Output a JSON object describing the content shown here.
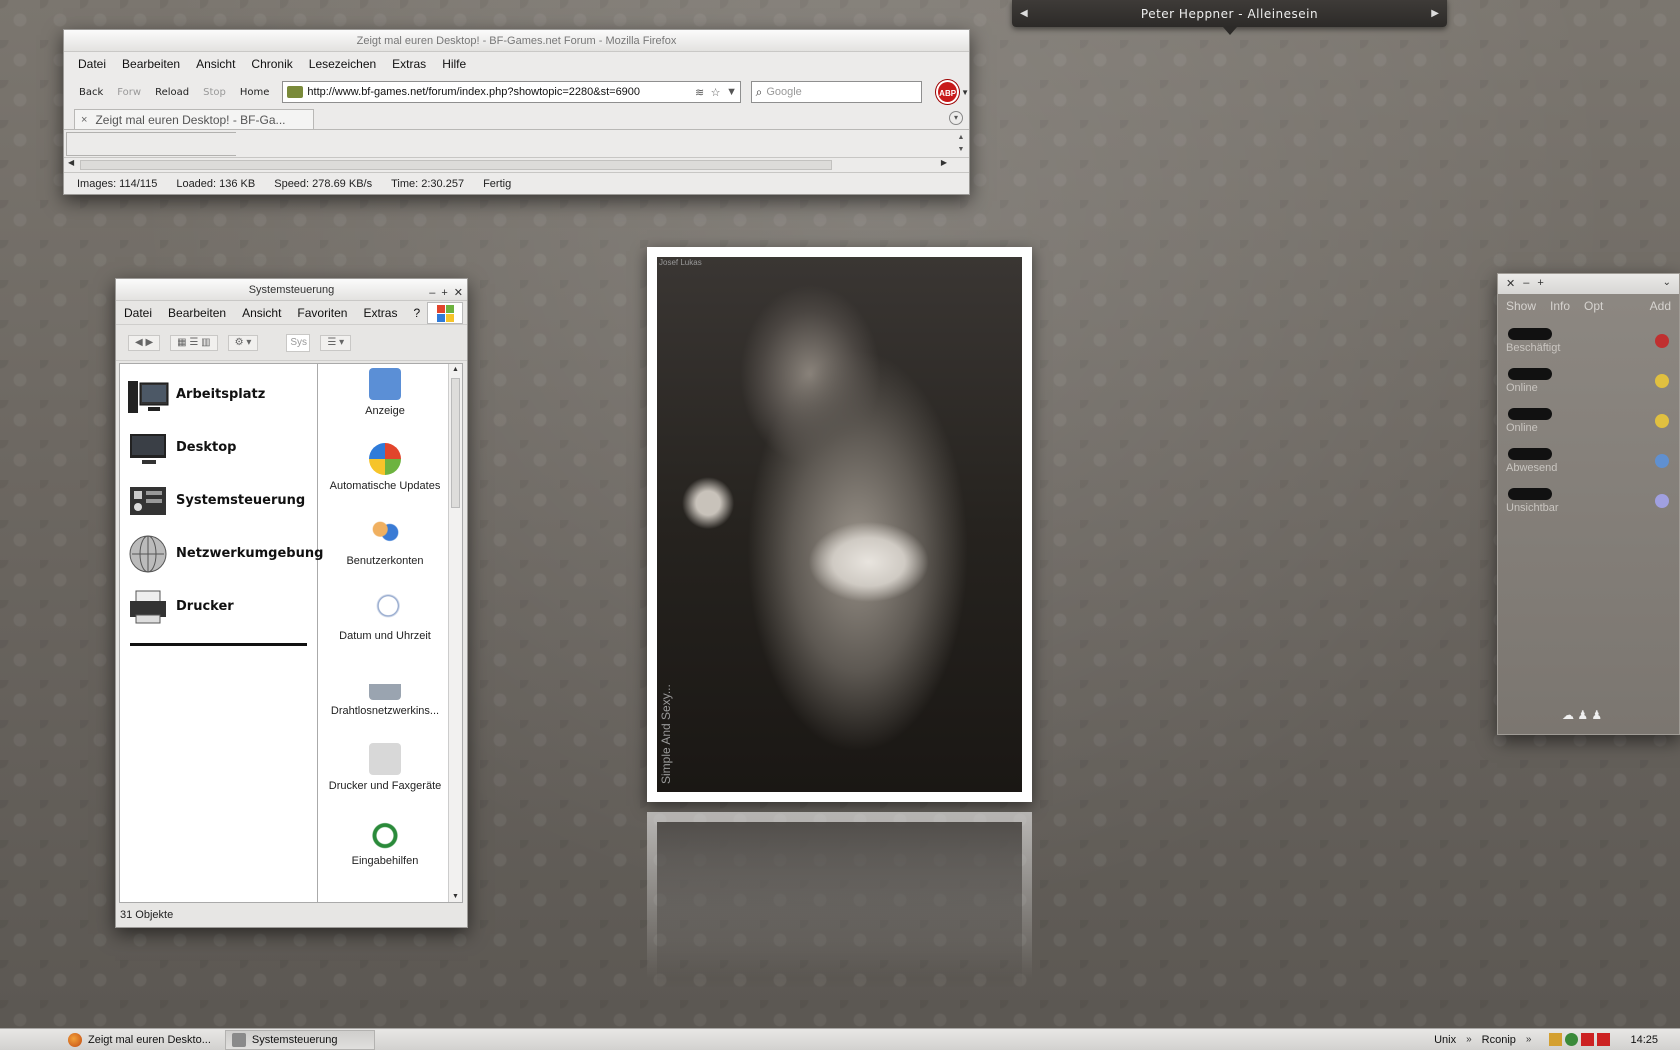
{
  "music": {
    "track": "Peter Heppner - Alleinesein",
    "prev_icon": "◀",
    "next_icon": "▶"
  },
  "firefox": {
    "title": "Zeigt mal euren Desktop! - BF-Games.net Forum - Mozilla Firefox",
    "menu": [
      "Datei",
      "Bearbeiten",
      "Ansicht",
      "Chronik",
      "Lesezeichen",
      "Extras",
      "Hilfe"
    ],
    "nav": {
      "back": "Back",
      "forward": "Forw",
      "reload": "Reload",
      "stop": "Stop",
      "home": "Home"
    },
    "url": "http://www.bf-games.net/forum/index.php?showtopic=2280&st=6900",
    "search_placeholder": "Google",
    "abp_label": "ABP",
    "tab_title": "Zeigt mal euren Desktop! - BF-Ga...",
    "tab_close": "×",
    "status": {
      "images": "Images: 114/115",
      "loaded": "Loaded: 136 KB",
      "speed": "Speed: 278.69 KB/s",
      "time": "Time: 2:30.257",
      "state": "Fertig"
    }
  },
  "systemsteuerung": {
    "title": "Systemsteuerung",
    "controls": [
      "‒",
      "+",
      "✕"
    ],
    "menu": [
      "Datei",
      "Bearbeiten",
      "Ansicht",
      "Favoriten",
      "Extras",
      "?"
    ],
    "search_placeholder": "Sys",
    "left_items": [
      {
        "label": "Arbeitsplatz",
        "icon": "computer-icon"
      },
      {
        "label": "Desktop",
        "icon": "monitor-icon"
      },
      {
        "label": "Systemsteuerung",
        "icon": "control-panel-icon"
      },
      {
        "label": "Netzwerkumgebung",
        "icon": "globe-icon"
      },
      {
        "label": "Drucker",
        "icon": "printer-icon"
      }
    ],
    "right_items": [
      {
        "label": "Anzeige",
        "icon": "display-settings-icon",
        "color": "#5b8fd6"
      },
      {
        "label": "Automatische Updates",
        "icon": "windows-update-icon",
        "color": "#3a8a2a"
      },
      {
        "label": "Benutzerkonten",
        "icon": "user-accounts-icon",
        "color": "#d08a2a"
      },
      {
        "label": "Datum und Uhrzeit",
        "icon": "clock-icon",
        "color": "#8aa0c8"
      },
      {
        "label": "Drahtlosnetzwerkins...",
        "icon": "wireless-icon",
        "color": "#6a9a3a"
      },
      {
        "label": "Drucker und Faxgeräte",
        "icon": "printer-fax-icon",
        "color": "#c8c8c8"
      },
      {
        "label": "Eingabehilfen",
        "icon": "accessibility-icon",
        "color": "#2a8a3a"
      }
    ],
    "status": "31 Objekte"
  },
  "photo": {
    "watermark_top": "Josef Lukas",
    "watermark_side": "Simple And Sexy..."
  },
  "contacts": {
    "controls": [
      "✕",
      "‒",
      "+"
    ],
    "tabs": [
      "Show",
      "Info",
      "Opt"
    ],
    "add": "Add",
    "list": [
      {
        "status": "Beschäftigt",
        "color": "#c03030"
      },
      {
        "status": "Online",
        "color": "#e0c040"
      },
      {
        "status": "Online",
        "color": "#e0c040"
      },
      {
        "status": "Abwesend",
        "color": "#6090d0"
      },
      {
        "status": "Unsichtbar",
        "color": "#a0a0e0"
      }
    ]
  },
  "taskbar": {
    "tasks": [
      {
        "label": "Zeigt mal euren Deskto...",
        "active": false,
        "color": "#d05a1a"
      },
      {
        "label": "Systemsteuerung",
        "active": true,
        "color": "#8a8a8a"
      }
    ],
    "tray": [
      "Unix",
      "Rconip"
    ],
    "clock": "14:25"
  }
}
